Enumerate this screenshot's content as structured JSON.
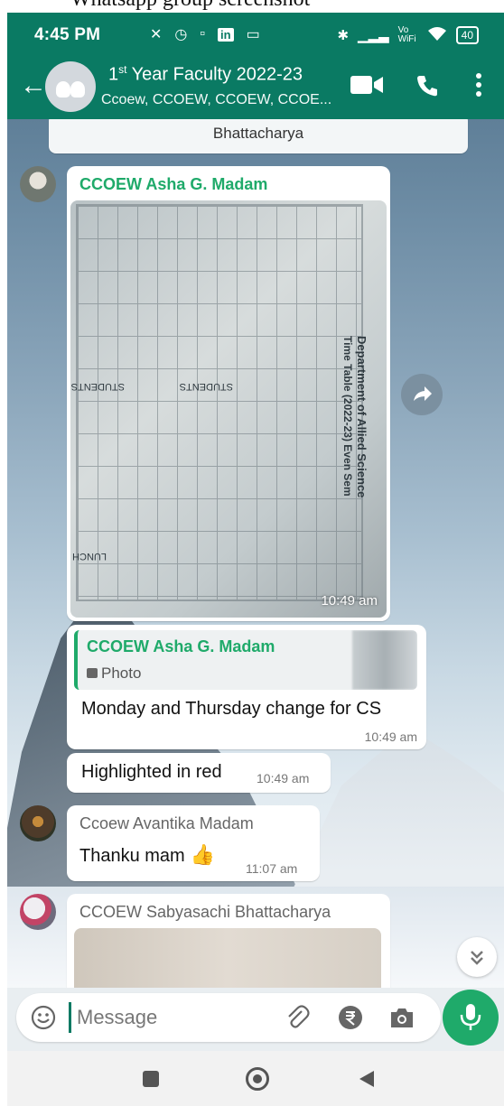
{
  "caption": "Whatsapp group screenshot",
  "status_bar": {
    "time": "4:45 PM",
    "battery": "40",
    "wifi_label": "Vo WiFi"
  },
  "header": {
    "title_prefix": "1",
    "title_sup": "st",
    "title_rest": " Year Faculty 2022-23",
    "subtitle": "Ccoew, CCOEW, CCOEW, CCOE..."
  },
  "messages": {
    "system": "Bhattacharya",
    "m1": {
      "sender": "CCOEW Asha G. Madam",
      "time": "10:49 am",
      "photo_text": {
        "title": "Department of Allied Science",
        "sub": "Time Table (2022-23) Even Sem",
        "break": "LUNCH BREAK",
        "col": "STUDENTS"
      }
    },
    "m2": {
      "quote_sender": "CCOEW Asha G. Madam",
      "quote_type": "Photo",
      "text": "Monday and Thursday change for CS",
      "time": "10:49 am"
    },
    "m3": {
      "text": "Highlighted in red",
      "time": "10:49 am"
    },
    "m4": {
      "sender": "Ccoew Avantika Madam",
      "text": "Thanku mam",
      "time": "11:07 am"
    },
    "m5": {
      "sender": "CCOEW Sabyasachi Bhattacharya"
    }
  },
  "input": {
    "placeholder": "Message"
  },
  "colors": {
    "header": "#0a7a63",
    "accent": "#1faa6a"
  }
}
